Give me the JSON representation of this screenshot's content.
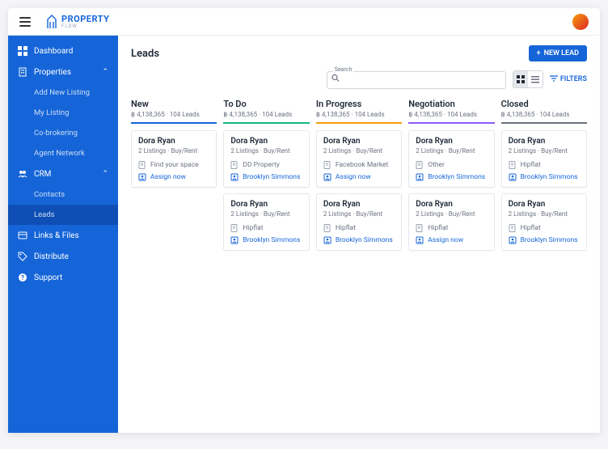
{
  "brand": {
    "name": "PROPERTY",
    "sub": "FLOW"
  },
  "sidebar": {
    "items": [
      {
        "label": "Dashboard",
        "icon": "dashboard"
      },
      {
        "label": "Properties",
        "icon": "building",
        "expanded": true,
        "children": [
          {
            "label": "Add New Listing"
          },
          {
            "label": "My Listing"
          },
          {
            "label": "Co-brokering"
          },
          {
            "label": "Agent Network"
          }
        ]
      },
      {
        "label": "CRM",
        "icon": "people",
        "expanded": true,
        "children": [
          {
            "label": "Contacts"
          },
          {
            "label": "Leads",
            "active": true
          }
        ]
      },
      {
        "label": "Links & Files",
        "icon": "link"
      },
      {
        "label": "Distribute",
        "icon": "tag"
      },
      {
        "label": "Support",
        "icon": "help"
      }
    ]
  },
  "page": {
    "title": "Leads",
    "new_lead": "NEW LEAD",
    "search_label": "Search",
    "filters": "FILTERS"
  },
  "columns": [
    {
      "title": "New",
      "meta": "฿ 4,138,365 · 104 Leads",
      "color": "#1565d8"
    },
    {
      "title": "To Do",
      "meta": "฿ 4,138,365 · 104 Leads",
      "color": "#10b981"
    },
    {
      "title": "In  Progress",
      "meta": "฿ 4,138,365 · 104 Leads",
      "color": "#f59e0b"
    },
    {
      "title": "Negotiation",
      "meta": "฿ 4,138,365 · 104 Leads",
      "color": "#8b5cf6"
    },
    {
      "title": "Closed",
      "meta": "฿ 4,138,365 · 104 Leads",
      "color": "#6b7280"
    }
  ],
  "cards": {
    "c0": [
      {
        "name": "Dora Ryan",
        "sub": "2 Listings · Buy/Rent",
        "source": "Find your space",
        "assignee": "Assign now",
        "isAssign": true
      }
    ],
    "c1": [
      {
        "name": "Dora Ryan",
        "sub": "2 Listings · Buy/Rent",
        "source": "DD Property",
        "assignee": "Brooklyn Simmons"
      },
      {
        "name": "Dora Ryan",
        "sub": "2 Listings · Buy/Rent",
        "source": "Hipflat",
        "assignee": "Brooklyn Simmons"
      }
    ],
    "c2": [
      {
        "name": "Dora Ryan",
        "sub": "2 Listings · Buy/Rent",
        "source": "Facebook Market",
        "assignee": "Assign now",
        "isAssign": true
      },
      {
        "name": "Dora Ryan",
        "sub": "2 Listings · Buy/Rent",
        "source": "Hipflat",
        "assignee": "Brooklyn Simmons"
      }
    ],
    "c3": [
      {
        "name": "Dora Ryan",
        "sub": "2 Listings · Buy/Rent",
        "source": "Other",
        "assignee": "Brooklyn Simmons"
      },
      {
        "name": "Dora Ryan",
        "sub": "2 Listings · Buy/Rent",
        "source": "Hipflat",
        "assignee": "Assign now",
        "isAssign": true
      }
    ],
    "c4": [
      {
        "name": "Dora Ryan",
        "sub": "2 Listings · Buy/Rent",
        "source": "Hipflat",
        "assignee": "Brooklyn Simmons"
      },
      {
        "name": "Dora Ryan",
        "sub": "2 Listings · Buy/Rent",
        "source": "Hipflat",
        "assignee": "Brooklyn Simmons"
      }
    ]
  }
}
